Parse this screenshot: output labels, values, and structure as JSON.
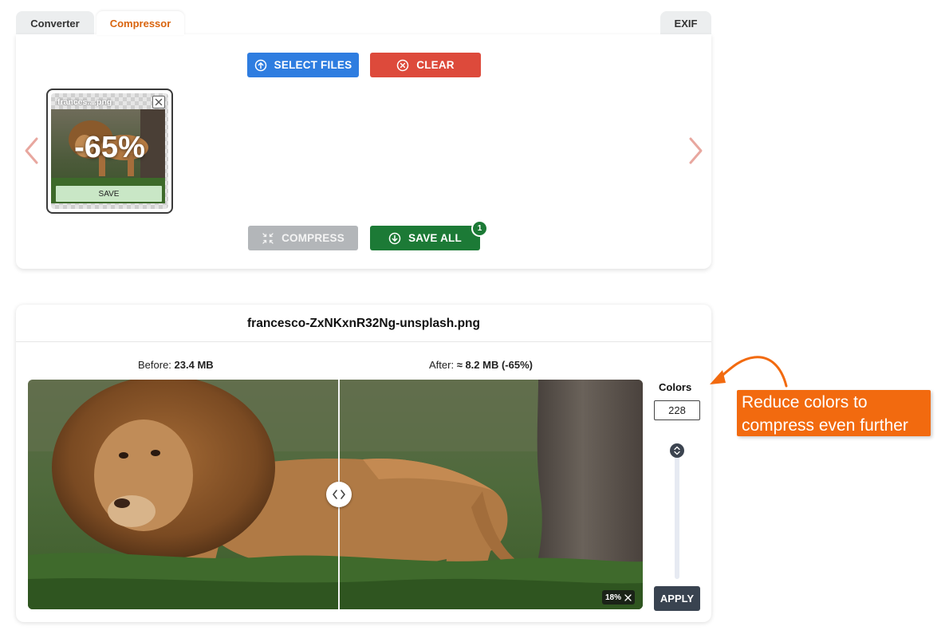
{
  "tabs": [
    {
      "label": "Converter"
    },
    {
      "label": "Compressor",
      "active": true
    },
    {
      "label": "EXIF"
    }
  ],
  "toolbar": {
    "select_files_label": "SELECT FILES",
    "clear_label": "CLEAR",
    "compress_label": "COMPRESS",
    "save_all_label": "SAVE ALL",
    "save_all_badge": "1"
  },
  "thumbnail": {
    "name": "frances....png",
    "percent": "-65%",
    "save_label": "SAVE"
  },
  "preview": {
    "file_name": "francesco-ZxNKxnR32Ng-unsplash.png",
    "before_label": "Before:",
    "before_value": "23.4 MB",
    "after_label": "After:",
    "after_value": "≈ 8.2 MB (-65%)",
    "zoom_label": "18%"
  },
  "colors_panel": {
    "label": "Colors",
    "value": "228",
    "apply_label": "APPLY"
  },
  "annotation": {
    "line1": "Reduce colors to",
    "line2": "compress even further"
  },
  "colors": {
    "accent_orange": "#f26a0f",
    "select_blue": "#2e7de0",
    "clear_red": "#dd4a3b",
    "save_green": "#1c7a36",
    "compress_grey": "#b3b6b9"
  }
}
